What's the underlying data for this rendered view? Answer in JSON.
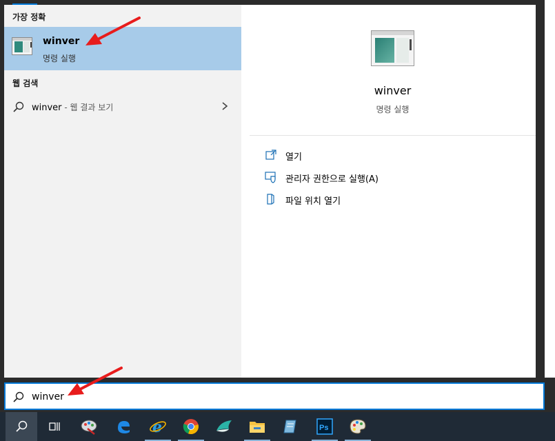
{
  "results": {
    "best_match_heading": "가장 정확",
    "best_match": {
      "title": "winver",
      "subtitle": "명령 실행",
      "icon": "window-app-icon"
    },
    "web_heading": "웹 검색",
    "web_item": {
      "query": "winver",
      "suffix": " - 웹 결과 보기",
      "icon": "search-icon"
    }
  },
  "preview": {
    "title": "winver",
    "subtitle": "명령 실행",
    "actions": [
      {
        "label": "열기",
        "icon": "open-icon"
      },
      {
        "label": "관리자 권한으로 실행(A)",
        "icon": "shield-icon"
      },
      {
        "label": "파일 위치 열기",
        "icon": "folder-location-icon"
      }
    ]
  },
  "search": {
    "value": "winver",
    "icon": "search-icon"
  },
  "taskbar": {
    "items": [
      {
        "name": "start-search",
        "icon": "search-icon"
      },
      {
        "name": "task-view",
        "icon": "task-view-icon"
      },
      {
        "name": "paint-app",
        "icon": "paint-icon"
      },
      {
        "name": "edge",
        "icon": "edge-icon"
      },
      {
        "name": "internet-explorer",
        "icon": "ie-icon"
      },
      {
        "name": "chrome",
        "icon": "chrome-icon"
      },
      {
        "name": "app-bird",
        "icon": "bird-icon"
      },
      {
        "name": "file-explorer",
        "icon": "folder-icon"
      },
      {
        "name": "notepad",
        "icon": "notepad-icon"
      },
      {
        "name": "photoshop",
        "icon": "photoshop-icon",
        "label": "Ps"
      },
      {
        "name": "paint-palette",
        "icon": "palette-icon"
      }
    ]
  },
  "colors": {
    "accent": "#0078d7",
    "selection": "#a7cbe9",
    "frame": "#2b2b2b",
    "taskbar": "#1f2a36",
    "annotation": "#e81c1c"
  }
}
